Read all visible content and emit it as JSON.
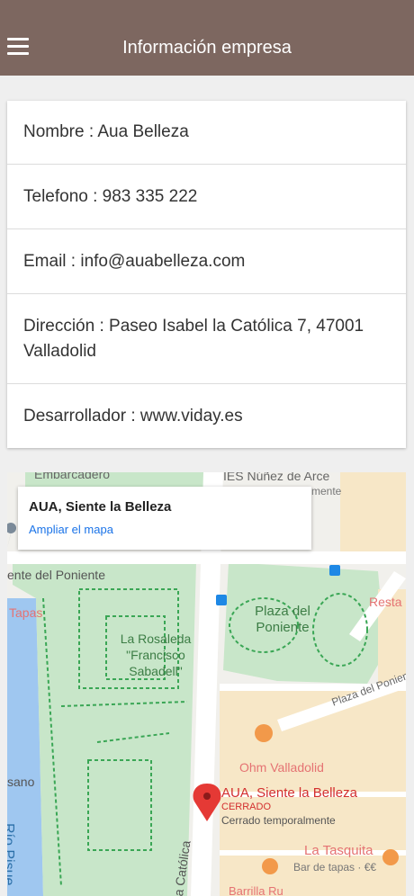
{
  "header": {
    "title": "Información empresa",
    "menu_icon": "hamburger-menu-icon"
  },
  "info": {
    "nombre": "Nombre : Aua Belleza",
    "telefono": "Telefono : 983 335 222",
    "email": "Email : info@auabelleza.com",
    "direccion": "Dirección : Paseo Isabel la Católica 7, 47001 Valladolid",
    "desarrollador": "Desarrollador : www.viday.es"
  },
  "map": {
    "infobox": {
      "place_name": "AUA, Siente la Belleza",
      "link": "Ampliar el mapa"
    },
    "labels": {
      "embarcadero": "Embarcadero",
      "ies": "IES Núñez de Arce",
      "mente": "mente",
      "poniente_street": "ente del Poniente",
      "tapas_left": "Tapas",
      "resta": "Resta",
      "rosaleda": "La Rosaleda \"Francisco Sabadell\"",
      "plaza": "Plaza del Poniente",
      "plaza_road": "Plaza del Poniente",
      "ohm": "Ohm Valladolid",
      "marker_name": "AUA, Siente la Belleza",
      "marker_status": "CERRADO",
      "marker_note": "Cerrado temporalmente",
      "tasquita": "La Tasquita",
      "tasquita_note": "Bar de tapas · €€",
      "sano": "sano",
      "rio": "Río Pisue",
      "catolica": "a Católica",
      "bottom": "Barrilla Ru"
    },
    "colors": {
      "park": "#c8e6c9",
      "river": "#9fc7f0",
      "marker": "#e53935",
      "poi": "#f2994a"
    }
  }
}
